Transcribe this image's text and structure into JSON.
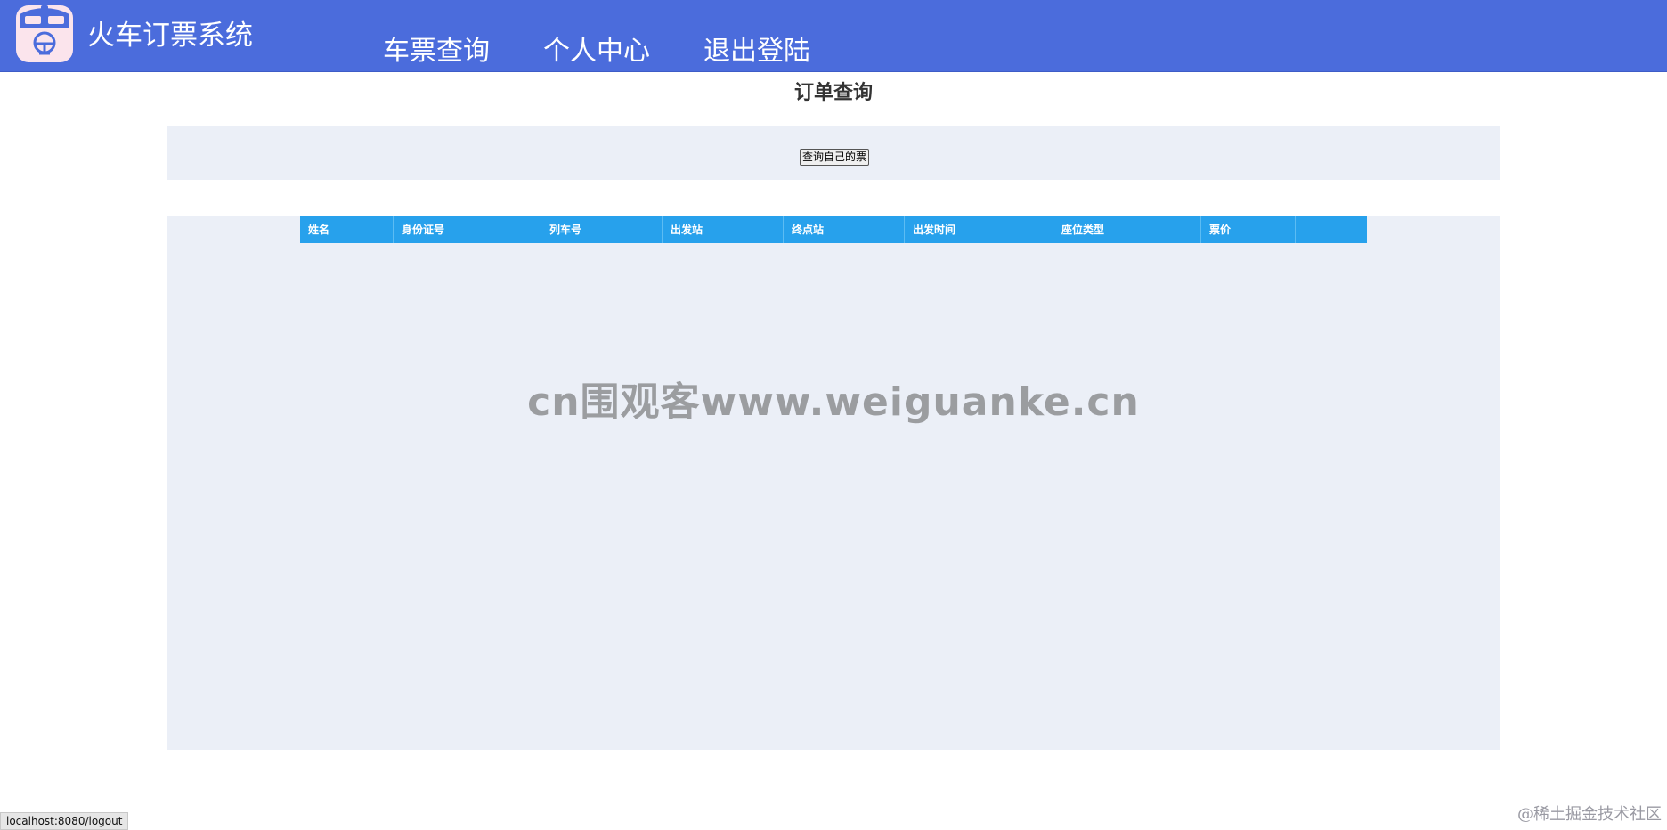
{
  "header": {
    "app_title": "火车订票系统",
    "logo_icon": "train-icon",
    "nav": [
      {
        "label": "车票查询"
      },
      {
        "label": "个人中心"
      },
      {
        "label": "退出登陆"
      }
    ],
    "colors": {
      "bar": "#4b6cdc",
      "text": "#ffffff"
    }
  },
  "main": {
    "title": "订单查询",
    "query_button_label": "查询自己的票",
    "table": {
      "columns": [
        "姓名",
        "身份证号",
        "列车号",
        "出发站",
        "终点站",
        "出发时间",
        "座位类型",
        "票价",
        ""
      ],
      "rows": [],
      "header_color": "#27a1ec"
    }
  },
  "overlays": {
    "watermark": "cn围观客www.weiguanke.cn",
    "status_url": "localhost:8080/logout",
    "corner_watermark": "@稀土掘金技术社区"
  }
}
